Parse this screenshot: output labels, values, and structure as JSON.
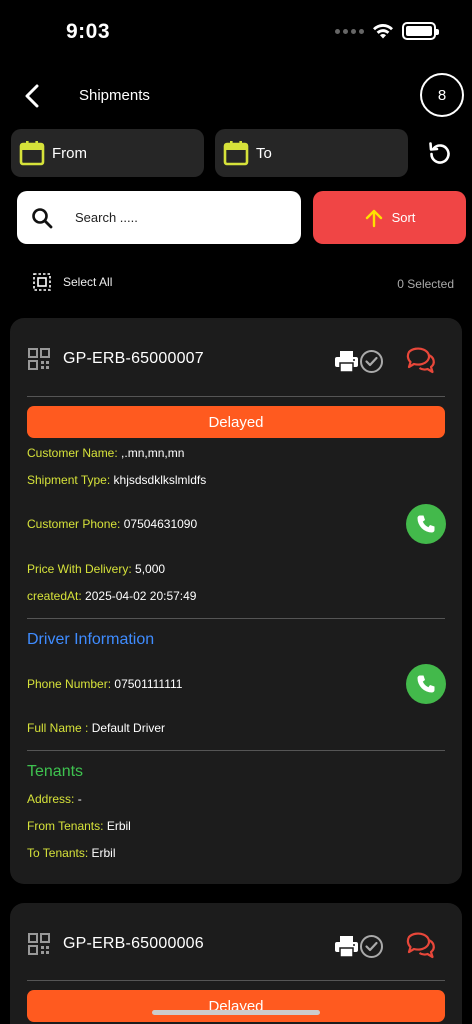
{
  "status_bar": {
    "time": "9:03",
    "icons": [
      "cellular-dots-icon",
      "wifi-icon",
      "battery-icon"
    ]
  },
  "nav": {
    "title": "Shipments",
    "count": "8",
    "back_icon": "chevron-left-icon"
  },
  "filters": {
    "from_label": "From",
    "to_label": "To",
    "date_icon": "calendar-icon",
    "refresh_icon": "refresh-icon"
  },
  "search": {
    "placeholder": "Search .....",
    "value": "",
    "icon": "search-icon"
  },
  "sort": {
    "label": "Sort",
    "icon": "arrow-up-icon"
  },
  "selection": {
    "select_all_label": "Select All",
    "selected_text": "0 Selected"
  },
  "colors": {
    "background": "#000000",
    "card": "#1c1c1c",
    "accent_red": "#f04545",
    "status_orange": "#ff5a1f",
    "field_key": "#d6e23a",
    "driver_blue": "#3f8cff",
    "tenants_green": "#3ec24f",
    "call_green": "#43b94b",
    "chat_red": "#e8473a"
  },
  "shipments": [
    {
      "code": "GP-ERB-65000007",
      "status": "Delayed",
      "customer_name_key": "Customer Name:",
      "customer_name": ",.mn,mn,mn",
      "shipment_type_key": "Shipment Type:",
      "shipment_type": "khjsdsdklkslmldfs",
      "customer_phone_key": "Customer Phone:",
      "customer_phone": "07504631090",
      "price_key": "Price With Delivery:",
      "price": "5,000",
      "created_key": "createdAt:",
      "created_at": "2025-04-02 20:57:49",
      "driver_title": "Driver Information",
      "driver_phone_key": "Phone Number:",
      "driver_phone": "07501111111",
      "driver_name_key": "Full Name :",
      "driver_name": "Default Driver",
      "tenants_title": "Tenants",
      "address_key": "Address:",
      "address": "-",
      "from_tenants_key": "From Tenants:",
      "from_tenants": "Erbil",
      "to_tenants_key": "To Tenants:",
      "to_tenants": "Erbil"
    },
    {
      "code": "GP-ERB-65000006",
      "status": "Delayed"
    }
  ]
}
